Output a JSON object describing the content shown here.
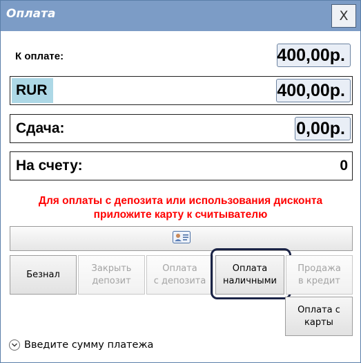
{
  "window": {
    "title": "Оплата",
    "close_label": "X"
  },
  "rows": {
    "to_pay": {
      "label": "К оплате:",
      "value": "400,00р."
    },
    "currency": {
      "label": "RUR",
      "value": "400,00р."
    },
    "change": {
      "label": "Сдача:",
      "value": "0,00р."
    },
    "on_account": {
      "label": "На счету:",
      "value": "0"
    }
  },
  "notice": {
    "line1": "Для оплаты с депозита или использования дисконта",
    "line2": "приложите карту к считывателю"
  },
  "card_reader": {
    "icon": "id-card-icon"
  },
  "buttons": {
    "cashless": "Безнал",
    "close_deposit": "Закрыть\nдепозит",
    "pay_deposit": "Оплата\nс депозита",
    "pay_cash": "Оплата\nналичными",
    "sell_credit": "Продажа\nв кредит",
    "pay_card": "Оплата с\nкарты"
  },
  "hint": {
    "icon": "chevron-down-circle-icon",
    "text": "Введите сумму платежа"
  },
  "colors": {
    "titlebar": "#7c9cc6",
    "notice": "#ff0000",
    "currency_highlight": "#add8e6",
    "focus_ring": "#1a2346",
    "disabled_text": "#a3a3a3"
  }
}
